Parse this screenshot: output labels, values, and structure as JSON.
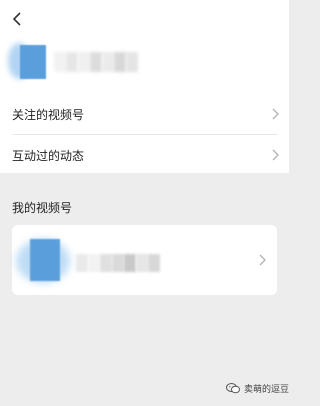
{
  "nav": {
    "back_icon": "chevron-left-icon"
  },
  "profile": {
    "name_pixels": [
      "#f2f2f2",
      "#e6e6e6",
      "#f0f0f0",
      "#dcdcdc",
      "#ebebeb",
      "#d8d8d8",
      "#e4e4e4"
    ]
  },
  "menu": {
    "followed": "关注的视频号",
    "interacted": "互动过的动态"
  },
  "my_channels": {
    "title": "我的视频号",
    "name_pixels": [
      "#eaeaea",
      "#f2f2f2",
      "#e0e0e0",
      "#dadada",
      "#c9c9c9",
      "#e6e6e6",
      "#d8d8d8"
    ]
  },
  "watermark": {
    "text": "卖萌的逗豆"
  },
  "colors": {
    "background": "#ededed",
    "surface": "#ffffff",
    "avatar_accent": "#5a9fdc",
    "chevron": "#b2b2b2"
  }
}
